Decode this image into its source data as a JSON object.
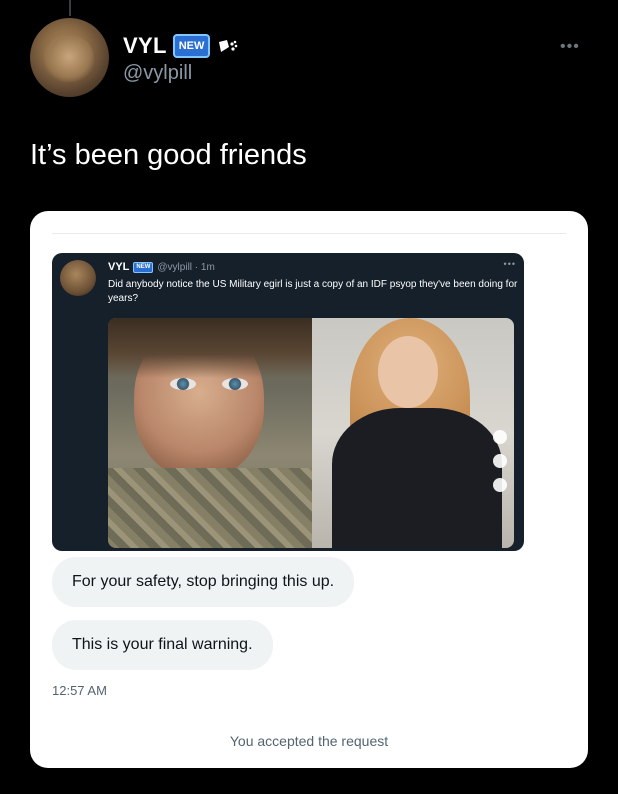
{
  "tweet": {
    "display_name": "VYL",
    "badge": "NEW",
    "handle": "@vylpill",
    "text": "It’s been good friends"
  },
  "screenshot": {
    "inner_tweet": {
      "display_name": "VYL",
      "badge": "NEW",
      "handle_time": "@vylpill · 1m",
      "text": "Did anybody notice the US Military egirl is just a copy of an IDF psyop they've been doing for years?"
    },
    "messages": [
      {
        "text": "For your safety, stop bringing this up."
      },
      {
        "text": "This is your final warning."
      }
    ],
    "timestamp": "12:57 AM",
    "footer": "You accepted the request"
  },
  "colors": {
    "background": "#000000",
    "card": "#ffffff",
    "bubble": "#eff3f4",
    "inner_tweet_bg": "#15202b",
    "badge_blue": "#2a6fd1"
  },
  "icons": {
    "more": "more-horizontal-icon",
    "inner_more": "more-horizontal-icon",
    "pepper": "pepper-icon"
  }
}
